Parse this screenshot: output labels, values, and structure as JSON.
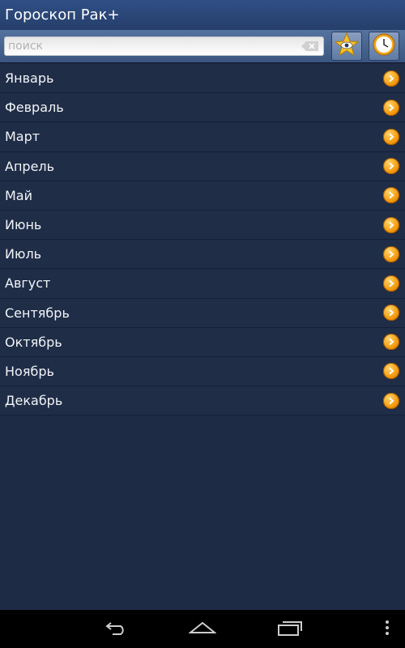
{
  "app": {
    "title": "Гороскоп Рак+"
  },
  "search": {
    "placeholder": "поиск",
    "value": ""
  },
  "toolbar": {
    "favorites_icon": "star-eye-icon",
    "time_icon": "clock-icon"
  },
  "months": [
    "Январь",
    "Февраль",
    "Март",
    "Апрель",
    "Май",
    "Июнь",
    "Июль",
    "Август",
    "Сентябрь",
    "Октябрь",
    "Ноябрь",
    "Декабрь"
  ],
  "colors": {
    "background": "#1e2b45",
    "titlebar": "#2f4f84",
    "arrow_accent": "#f39a0c"
  },
  "system_nav": {
    "icons": [
      "back-icon",
      "home-icon",
      "recents-icon",
      "overflow-menu-icon"
    ]
  }
}
